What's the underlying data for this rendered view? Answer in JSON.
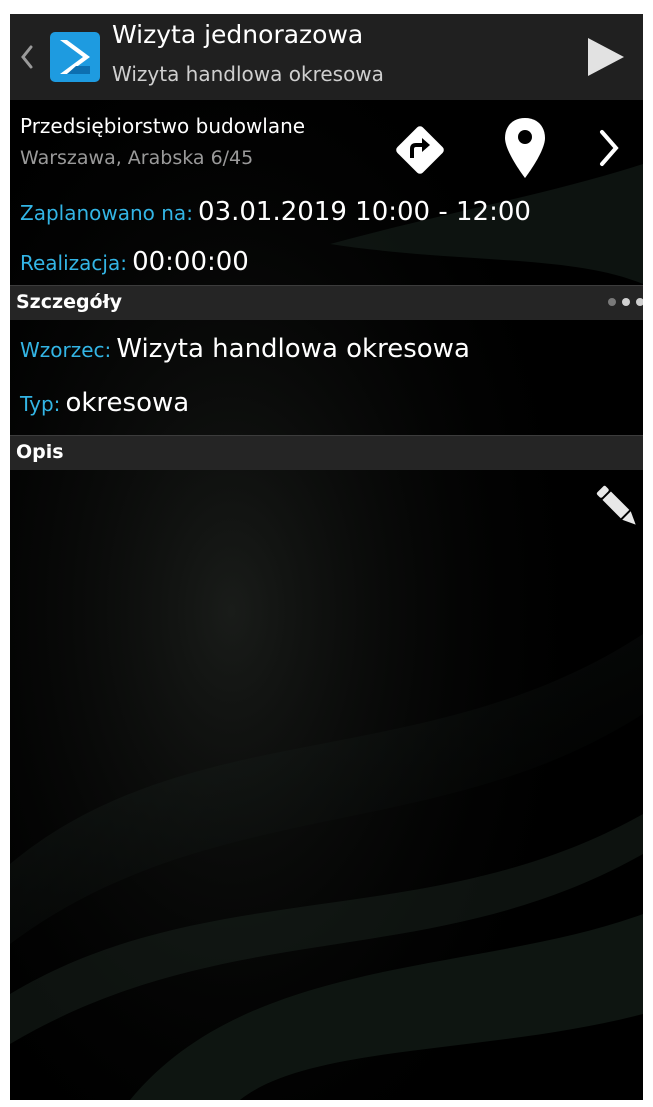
{
  "header": {
    "title": "Wizyta jednorazowa",
    "subtitle": "Wizyta handlowa okresowa",
    "back_icon": "back-chevron-icon",
    "play_icon": "play-icon"
  },
  "client": {
    "name": "Przedsiębiorstwo budowlane",
    "address": "Warszawa, Arabska 6/45"
  },
  "schedule": {
    "planned_label": "Zaplanowano na:",
    "planned_value": "03.01.2019 10:00 - 12:00",
    "realization_label": "Realizacja:",
    "realization_value": "00:00:00"
  },
  "details": {
    "section_title": "Szczegóły",
    "template_label": "Wzorzec:",
    "template_value": "Wizyta handlowa okresowa",
    "type_label": "Typ:",
    "type_value": "okresowa"
  },
  "description": {
    "section_title": "Opis"
  },
  "colors": {
    "accent": "#33b5e5",
    "header_bg": "#202020",
    "section_bg": "#252525",
    "logo_blue": "#1e9be0"
  }
}
